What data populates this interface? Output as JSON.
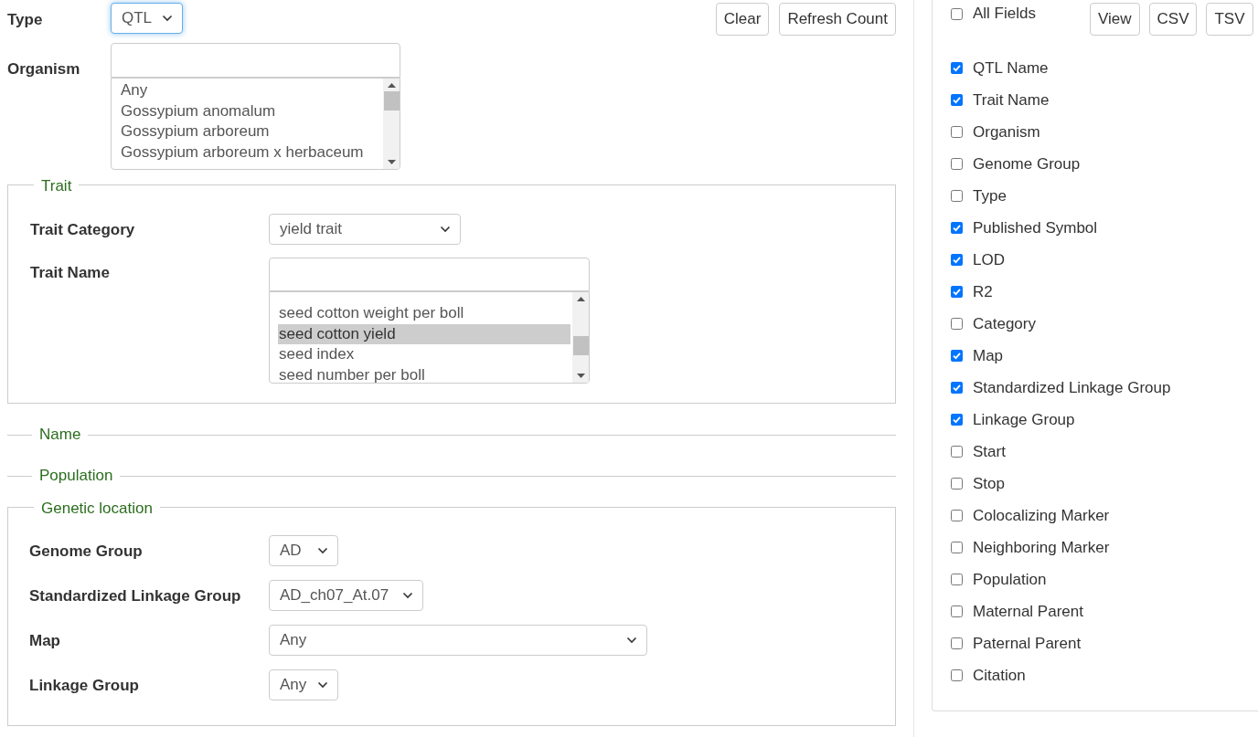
{
  "type_field": {
    "label": "Type",
    "value": "QTL",
    "focused": true
  },
  "actions": [
    "Clear",
    "Refresh Count"
  ],
  "organism": {
    "label": "Organism",
    "options": [
      {
        "label": "Any",
        "selected": false
      },
      {
        "label": "Gossypium anomalum",
        "selected": false
      },
      {
        "label": "Gossypium arboreum",
        "selected": false
      },
      {
        "label": "Gossypium arboreum x herbaceum",
        "selected": false
      }
    ]
  },
  "trait": {
    "legend": "Trait",
    "category_label": "Trait Category",
    "category_value": "yield trait",
    "name_label": "Trait Name",
    "options": [
      {
        "label": "seed cotton weight per boll",
        "selected": false
      },
      {
        "label": "seed cotton yield",
        "selected": true
      },
      {
        "label": "seed index",
        "selected": false
      },
      {
        "label": "seed number per boll",
        "selected": false
      }
    ]
  },
  "collapsed_sections": [
    "Name",
    "Population"
  ],
  "genetic_location": {
    "legend": "Genetic location",
    "fields": [
      {
        "label": "Genome Group",
        "value": "AD"
      },
      {
        "label": "Standardized Linkage Group",
        "value": "AD_ch07_At.07"
      },
      {
        "label": "Map",
        "value": "Any"
      },
      {
        "label": "Linkage Group",
        "value": "Any"
      }
    ]
  },
  "output": {
    "all_fields": {
      "label": "All Fields",
      "checked": false
    },
    "buttons": [
      "View",
      "CSV",
      "TSV"
    ],
    "fields": [
      {
        "label": "QTL Name",
        "checked": true
      },
      {
        "label": "Trait Name",
        "checked": true
      },
      {
        "label": "Organism",
        "checked": false
      },
      {
        "label": "Genome Group",
        "checked": false
      },
      {
        "label": "Type",
        "checked": false
      },
      {
        "label": "Published Symbol",
        "checked": true
      },
      {
        "label": "LOD",
        "checked": true
      },
      {
        "label": "R2",
        "checked": true
      },
      {
        "label": "Category",
        "checked": false
      },
      {
        "label": "Map",
        "checked": true
      },
      {
        "label": "Standardized Linkage Group",
        "checked": true
      },
      {
        "label": "Linkage Group",
        "checked": true
      },
      {
        "label": "Start",
        "checked": false
      },
      {
        "label": "Stop",
        "checked": false
      },
      {
        "label": "Colocalizing Marker",
        "checked": false
      },
      {
        "label": "Neighboring Marker",
        "checked": false
      },
      {
        "label": "Population",
        "checked": false
      },
      {
        "label": "Maternal Parent",
        "checked": false
      },
      {
        "label": "Paternal Parent",
        "checked": false
      },
      {
        "label": "Citation",
        "checked": false
      }
    ]
  }
}
